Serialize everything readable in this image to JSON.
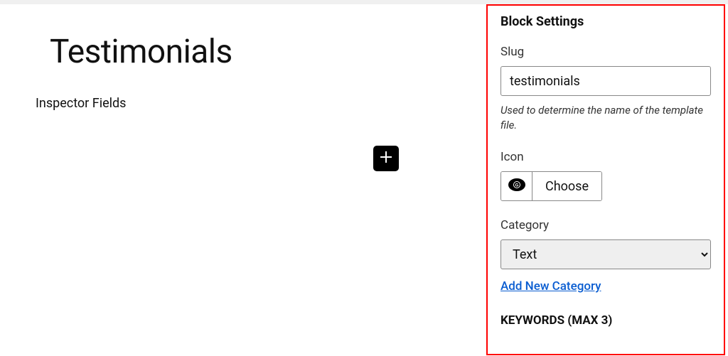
{
  "main": {
    "title": "Testimonials",
    "inspector_label": "Inspector Fields"
  },
  "sidebar": {
    "title": "Block Settings",
    "slug": {
      "label": "Slug",
      "value": "testimonials",
      "description": "Used to determine the name of the template file."
    },
    "icon": {
      "label": "Icon",
      "button": "Choose"
    },
    "category": {
      "label": "Category",
      "selected": "Text",
      "add_link": "Add New Category"
    },
    "keywords_heading": "KEYWORDS (MAX 3)"
  }
}
